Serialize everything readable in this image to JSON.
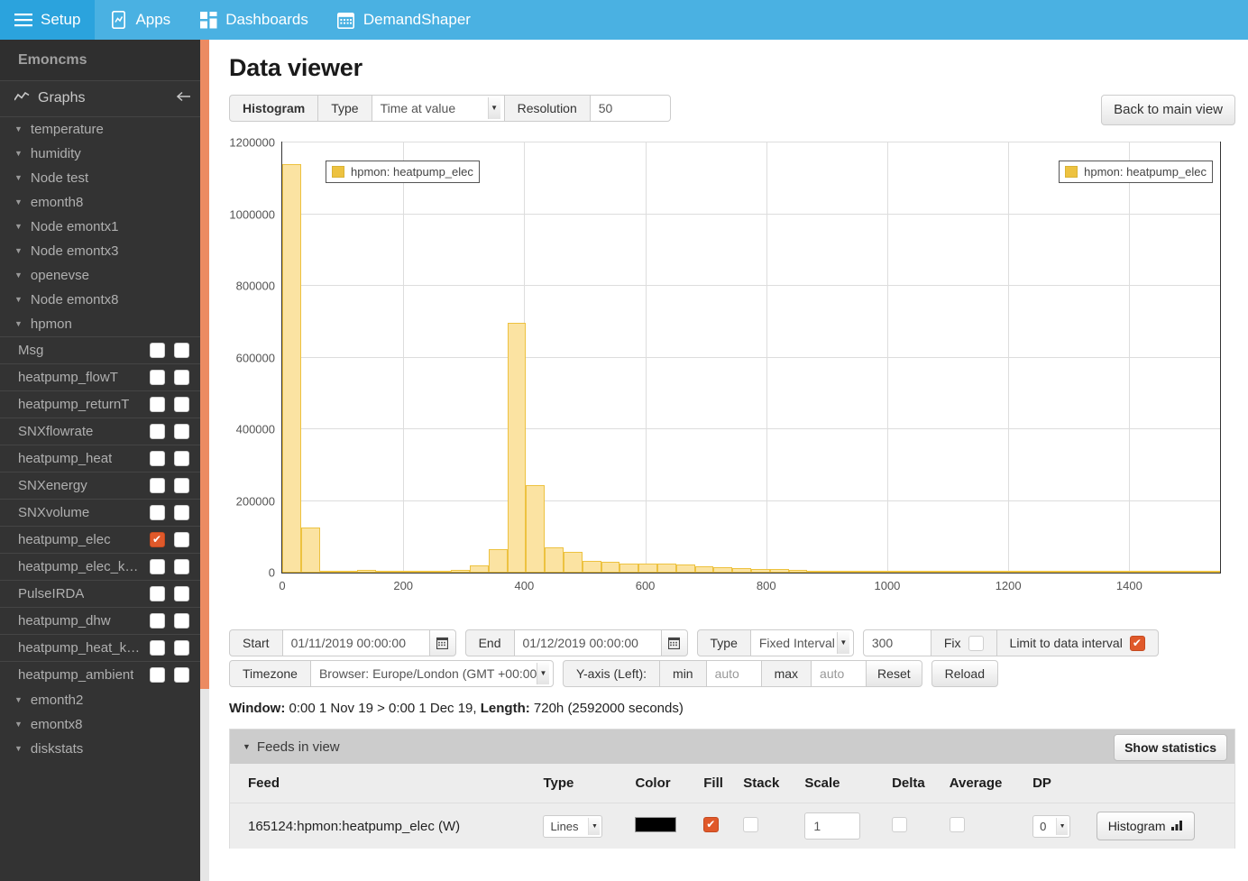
{
  "topnav": {
    "items": [
      {
        "label": "Setup",
        "icon": "hamburger-icon",
        "active": true
      },
      {
        "label": "Apps",
        "icon": "app-chart-icon",
        "active": false
      },
      {
        "label": "Dashboards",
        "icon": "dashboard-grid-icon",
        "active": false
      },
      {
        "label": "DemandShaper",
        "icon": "calendar-icon",
        "active": false
      }
    ]
  },
  "sidebar": {
    "brand": "Emoncms",
    "graphs_label": "Graphs",
    "graphs_icon": "line-chart-icon",
    "collapse_icon": "arrow-left-icon",
    "groups_before": [
      {
        "label": "temperature"
      },
      {
        "label": "humidity"
      },
      {
        "label": "Node test"
      },
      {
        "label": "emonth8"
      },
      {
        "label": "Node emontx1"
      },
      {
        "label": "Node emontx3"
      },
      {
        "label": "openevse"
      },
      {
        "label": "Node emontx8"
      },
      {
        "label": "hpmon"
      }
    ],
    "feeds": [
      {
        "label": "Msg",
        "left_checked": false,
        "right_checked": false
      },
      {
        "label": "heatpump_flowT",
        "left_checked": false,
        "right_checked": false
      },
      {
        "label": "heatpump_returnT",
        "left_checked": false,
        "right_checked": false
      },
      {
        "label": "SNXflowrate",
        "left_checked": false,
        "right_checked": false
      },
      {
        "label": "heatpump_heat",
        "left_checked": false,
        "right_checked": false
      },
      {
        "label": "SNXenergy",
        "left_checked": false,
        "right_checked": false
      },
      {
        "label": "SNXvolume",
        "left_checked": false,
        "right_checked": false
      },
      {
        "label": "heatpump_elec",
        "left_checked": true,
        "right_checked": false
      },
      {
        "label": "heatpump_elec_k…",
        "left_checked": false,
        "right_checked": false
      },
      {
        "label": "PulseIRDA",
        "left_checked": false,
        "right_checked": false
      },
      {
        "label": "heatpump_dhw",
        "left_checked": false,
        "right_checked": false
      },
      {
        "label": "heatpump_heat_k…",
        "left_checked": false,
        "right_checked": false
      },
      {
        "label": "heatpump_ambient",
        "left_checked": false,
        "right_checked": false
      }
    ],
    "groups_after": [
      {
        "label": "emonth2"
      },
      {
        "label": "emontx8"
      },
      {
        "label": "diskstats"
      }
    ],
    "scrollbar_color": "#ec8b62"
  },
  "page": {
    "title": "Data viewer"
  },
  "toolbar": {
    "histogram_label": "Histogram",
    "type_label": "Type",
    "type_value": "Time at value",
    "resolution_label": "Resolution",
    "resolution_value": "50",
    "back_label": "Back to main view"
  },
  "timecontrols": {
    "start_label": "Start",
    "start_value": "01/11/2019 00:00:00",
    "end_label": "End",
    "end_value": "01/12/2019 00:00:00",
    "type_label": "Type",
    "interval_value": "Fixed Interval",
    "interval_seconds": "300",
    "fix_label": "Fix",
    "fix_checked": false,
    "limit_label": "Limit to data interval",
    "limit_checked": true,
    "timezone_label": "Timezone",
    "timezone_value": "Browser: Europe/London (GMT +00:00)",
    "yaxis_label": "Y-axis (Left):",
    "min_label": "min",
    "min_value": "auto",
    "max_label": "max",
    "max_value": "auto",
    "reset_label": "Reset",
    "reload_label": "Reload",
    "calendar_icon": "calendar-icon"
  },
  "window_line": {
    "window_key": "Window:",
    "window_value": " 0:00 1 Nov 19 > 0:00 1 Dec 19, ",
    "length_key": "Length:",
    "length_value": " 720h (2592000 seconds)"
  },
  "feeds_panel": {
    "title": "Feeds in view",
    "collapse_icon": "caret-down-icon",
    "show_statistics_label": "Show statistics",
    "columns": [
      "Feed",
      "Type",
      "Color",
      "Fill",
      "Stack",
      "Scale",
      "Delta",
      "Average",
      "DP",
      ""
    ],
    "rows": [
      {
        "feed": "165124:hpmon:heatpump_elec (W)",
        "type": "Lines",
        "color": "#000000",
        "fill": true,
        "stack": false,
        "scale": "1",
        "delta": false,
        "average": false,
        "dp": "0",
        "action_label": "Histogram",
        "action_icon": "bar-chart-icon"
      }
    ]
  },
  "chart_data": {
    "type": "bar",
    "title": "",
    "xlabel": "",
    "ylabel": "",
    "legend_left": "hpmon: heatpump_elec",
    "legend_right": "hpmon: heatpump_elec",
    "series_color": "#edc240",
    "fill_color": "#fbe3a2",
    "grid": true,
    "xlim": [
      0,
      1550
    ],
    "ylim": [
      0,
      1200000
    ],
    "ytick_labels": [
      "0",
      "200000",
      "400000",
      "600000",
      "800000",
      "1000000",
      "1200000"
    ],
    "ytick_values": [
      0,
      200000,
      400000,
      600000,
      800000,
      1000000,
      1200000
    ],
    "xtick_labels": [
      "0",
      "200",
      "400",
      "600",
      "800",
      "1000",
      "1200",
      "1400"
    ],
    "xtick_values": [
      0,
      200,
      400,
      600,
      800,
      1000,
      1200,
      1400
    ],
    "bin_width": 31,
    "bins": [
      {
        "x": 0,
        "value": 1140000
      },
      {
        "x": 31,
        "value": 127000
      },
      {
        "x": 62,
        "value": 3500
      },
      {
        "x": 93,
        "value": 4000
      },
      {
        "x": 124,
        "value": 8000
      },
      {
        "x": 155,
        "value": 3500
      },
      {
        "x": 186,
        "value": 5000
      },
      {
        "x": 217,
        "value": 5000
      },
      {
        "x": 248,
        "value": 3000
      },
      {
        "x": 279,
        "value": 7000
      },
      {
        "x": 310,
        "value": 21000
      },
      {
        "x": 341,
        "value": 66000
      },
      {
        "x": 372,
        "value": 696000
      },
      {
        "x": 403,
        "value": 244000
      },
      {
        "x": 434,
        "value": 70000
      },
      {
        "x": 465,
        "value": 57000
      },
      {
        "x": 496,
        "value": 33000
      },
      {
        "x": 527,
        "value": 29000
      },
      {
        "x": 558,
        "value": 25000
      },
      {
        "x": 589,
        "value": 25000
      },
      {
        "x": 620,
        "value": 24000
      },
      {
        "x": 651,
        "value": 22000
      },
      {
        "x": 682,
        "value": 18000
      },
      {
        "x": 713,
        "value": 15000
      },
      {
        "x": 744,
        "value": 13000
      },
      {
        "x": 775,
        "value": 11000
      },
      {
        "x": 806,
        "value": 10000
      },
      {
        "x": 837,
        "value": 7000
      },
      {
        "x": 868,
        "value": 5000
      },
      {
        "x": 899,
        "value": 4000
      },
      {
        "x": 930,
        "value": 3000
      },
      {
        "x": 961,
        "value": 2500
      },
      {
        "x": 992,
        "value": 2500
      },
      {
        "x": 1023,
        "value": 2500
      },
      {
        "x": 1054,
        "value": 2000
      },
      {
        "x": 1085,
        "value": 2000
      },
      {
        "x": 1116,
        "value": 1500
      },
      {
        "x": 1147,
        "value": 1500
      },
      {
        "x": 1178,
        "value": 1500
      },
      {
        "x": 1209,
        "value": 1500
      },
      {
        "x": 1240,
        "value": 1200
      },
      {
        "x": 1271,
        "value": 1200
      },
      {
        "x": 1302,
        "value": 1200
      },
      {
        "x": 1333,
        "value": 1000
      },
      {
        "x": 1364,
        "value": 1000
      },
      {
        "x": 1395,
        "value": 1000
      },
      {
        "x": 1426,
        "value": 900
      },
      {
        "x": 1457,
        "value": 900
      },
      {
        "x": 1488,
        "value": 800
      },
      {
        "x": 1519,
        "value": 800
      }
    ]
  }
}
